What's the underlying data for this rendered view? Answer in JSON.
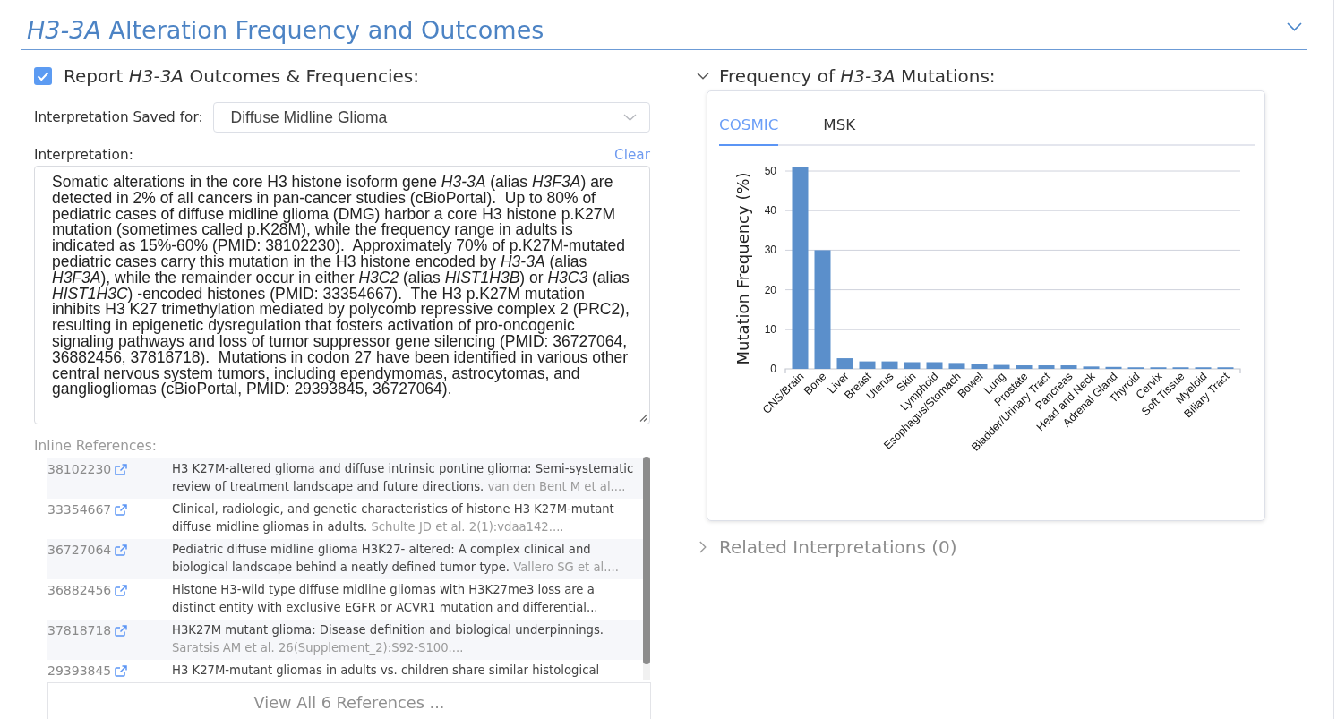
{
  "section": {
    "title": "*H3-3A* Alteration Frequency and Outcomes",
    "expanded": true
  },
  "report": {
    "label": "Report *H3-3A* Outcomes & Frequencies:",
    "checked": true
  },
  "saved_for": {
    "label": "Interpretation Saved for:",
    "value": "Diffuse Midline Glioma"
  },
  "interpretation": {
    "label": "Interpretation:",
    "clear": "Clear",
    "value": "Somatic alterations in the core H3 histone isoform gene *H3-3A* (alias *H3F3A*) are detected in 2% of all cancers in pan-cancer studies (cBioPortal).  Up to 80% of pediatric cases of diffuse midline glioma (DMG) harbor a core H3 histone p.K27M mutation (sometimes called p.K28M), while the frequency range in adults is indicated as 15%-60% (PMID: 38102230).  Approximately 70% of p.K27M-mutated pediatric cases carry this mutation in the H3 histone encoded by *H3-3A* (alias *H3F3A*), while the remainder occur in either *H3C2* (alias *HIST1H3B*) or *H3C3* (alias *HIST1H3C*) -encoded histones (PMID: 33354667).  The H3 p.K27M mutation inhibits H3 K27 trimethylation mediated by polycomb repressive complex 2 (PRC2), resulting in epigenetic dysregulation that fosters activation of pro-oncogenic signaling pathways and loss of tumor suppressor gene silencing (PMID: 36727064, 36882456, 37818718).  Mutations in codon 27 have been identified in various other central nervous system tumors, including ependymomas, astrocytomas, and gangliogliomas (cBioPortal, PMID: 29393845, 36727064)."
  },
  "references": {
    "label": "Inline References:",
    "items": [
      {
        "pmid": "38102230",
        "title": "H3 K27M-altered glioma and diffuse intrinsic pontine glioma: Semi-systematic review of treatment landscape and future directions.",
        "details": "van den Bent M et al...."
      },
      {
        "pmid": "33354667",
        "title": "Clinical, radiologic, and genetic characteristics of histone H3 K27M-mutant diffuse midline gliomas in adults.",
        "details": "Schulte JD et al. 2(1):vdaa142...."
      },
      {
        "pmid": "36727064",
        "title": "Pediatric diffuse midline glioma H3K27- altered: A complex clinical and biological landscape behind a neatly defined tumor type.",
        "details": "Vallero SG et al...."
      },
      {
        "pmid": "36882456",
        "title": "Histone H3-wild type diffuse midline gliomas with H3K27me3 loss are a distinct entity with exclusive EGFR or ACVR1 mutation and differential..."
      },
      {
        "pmid": "37818718",
        "title": "H3K27M mutant glioma: Disease definition and biological underpinnings.",
        "details": "Saratsis AM et al. 26(Supplement_2):S92-S100...."
      },
      {
        "pmid": "29393845",
        "title": "H3 K27M-mutant gliomas in adults vs. children share similar histological"
      }
    ],
    "view_all": "View All 6 References ..."
  },
  "frequency_panel": {
    "title": "Frequency of *H3-3A* Mutations:",
    "expanded": true,
    "tabs": [
      {
        "label": "COSMIC",
        "selected": true
      },
      {
        "label": "MSK",
        "selected": false
      }
    ],
    "chart_data": {
      "type": "bar",
      "ylabel": "Mutation Frequency (%)",
      "categories": [
        "CNS/Brain",
        "Bone",
        "Liver",
        "Breast",
        "Uterus",
        "Skin",
        "Lymphoid",
        "Esophagus/Stomach",
        "Bowel",
        "Lung",
        "Prostate",
        "Bladder/Urinary Tract",
        "Pancreas",
        "Head and Neck",
        "Adrenal Gland",
        "Thyroid",
        "Cervix",
        "Soft Tissue",
        "Myeloid",
        "Biliary Tract"
      ],
      "values": [
        51,
        30,
        2.7,
        1.9,
        1.9,
        1.7,
        1.7,
        1.5,
        1.3,
        1.0,
        0.9,
        0.9,
        0.9,
        0.6,
        0.5,
        0.4,
        0.4,
        0.4,
        0.4,
        0.4
      ],
      "ylim": [
        0,
        51
      ],
      "yticks": [
        0,
        10,
        20,
        30,
        40,
        50
      ],
      "grid": true
    }
  },
  "related_panel": {
    "title": "Related Interpretations (0)",
    "expanded": false
  }
}
